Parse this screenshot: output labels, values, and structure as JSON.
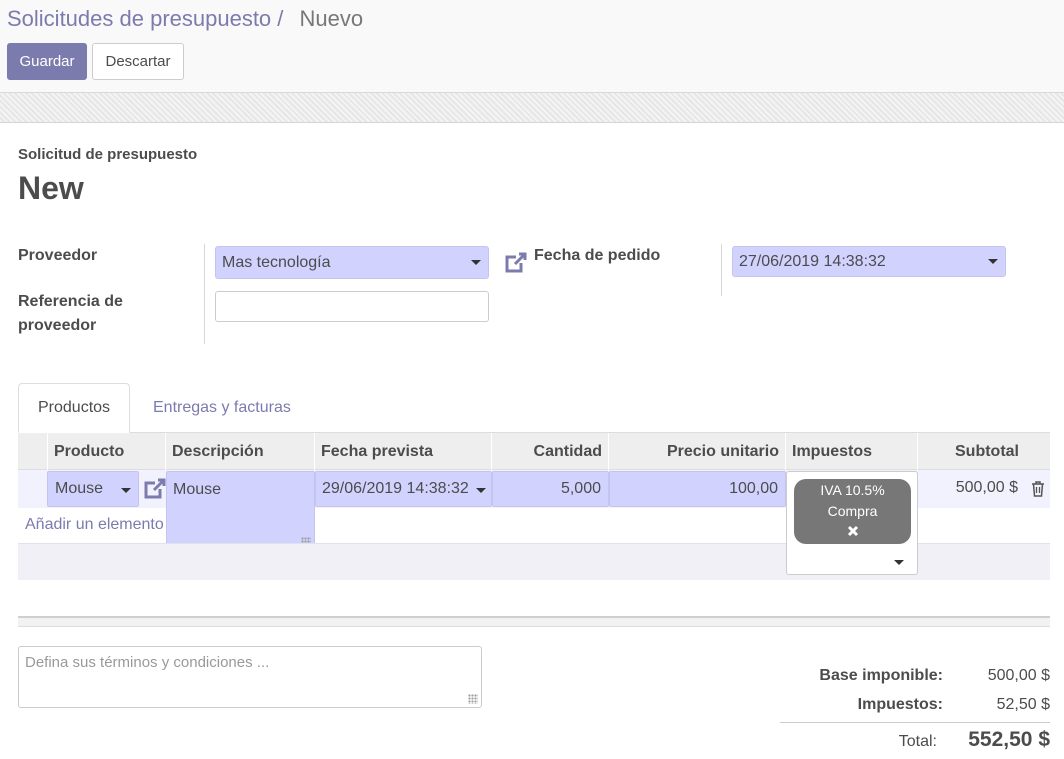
{
  "breadcrumb": {
    "parent": "Solicitudes de presupuesto",
    "separator": "/",
    "current": "Nuevo"
  },
  "buttons": {
    "save": "Guardar",
    "discard": "Descartar"
  },
  "document": {
    "label": "Solicitud de presupuesto",
    "title": "New"
  },
  "fields": {
    "vendor_label": "Proveedor",
    "vendor_value": "Mas tecnología",
    "vendor_ref_label": "Referencia de proveedor",
    "vendor_ref_value": "",
    "order_date_label": "Fecha de pedido",
    "order_date_value": "27/06/2019 14:38:32"
  },
  "tabs": [
    {
      "label": "Productos",
      "active": true
    },
    {
      "label": "Entregas y facturas",
      "active": false
    }
  ],
  "table": {
    "columns": [
      "Producto",
      "Descripción",
      "Fecha prevista",
      "Cantidad",
      "Precio unitario",
      "Impuestos",
      "Subtotal"
    ],
    "rows": [
      {
        "product": "Mouse",
        "description": "Mouse",
        "scheduled_date": "29/06/2019 14:38:32",
        "quantity": "5,000",
        "unit_price": "100,00",
        "taxes": [
          "IVA 10.5%",
          "Compra"
        ],
        "subtotal": "500,00 $"
      }
    ],
    "add_line": "Añadir un elemento"
  },
  "notes_placeholder": "Defina sus términos y condiciones ...",
  "summary": {
    "untaxed_label": "Base imponible:",
    "untaxed_value": "500,00 $",
    "taxes_label": "Impuestos:",
    "taxes_value": "52,50 $",
    "total_label": "Total:",
    "total_value": "552,50 $"
  },
  "icons": {
    "external_link": "external-link-icon",
    "dropdown": "chevron-down-icon",
    "delete": "trash-icon",
    "remove_tag": "close-icon"
  },
  "colors": {
    "accent": "#7c7bad",
    "field_bg": "#d2d2ff",
    "tag_bg": "#777777"
  }
}
